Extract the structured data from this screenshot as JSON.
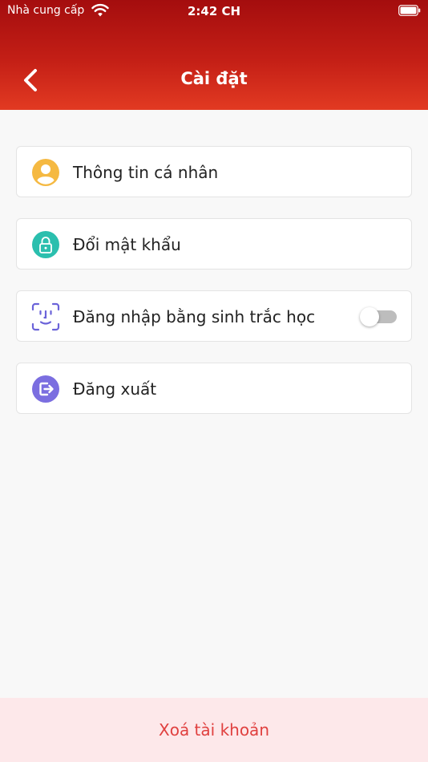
{
  "status_bar": {
    "carrier": "Nhà cung cấp",
    "time": "2:42 CH"
  },
  "header": {
    "title": "Cài đặt"
  },
  "menu": {
    "items": [
      {
        "label": "Thông tin cá nhân",
        "icon": "user-icon",
        "color": "#f5b942"
      },
      {
        "label": "Đổi mật khẩu",
        "icon": "lock-icon",
        "color": "#2bbfae"
      },
      {
        "label": "Đăng nhập bằng sinh trắc học",
        "icon": "face-id-icon",
        "color": "#6b63d9",
        "toggle_on": false
      },
      {
        "label": "Đăng xuất",
        "icon": "logout-icon",
        "color": "#7b6ee0"
      }
    ]
  },
  "footer": {
    "delete_account_label": "Xoá tài khoản"
  },
  "colors": {
    "header_top": "#a40d0e",
    "header_bottom": "#e23a22",
    "danger_text": "#e0403f",
    "danger_bg": "#fde8ea"
  }
}
